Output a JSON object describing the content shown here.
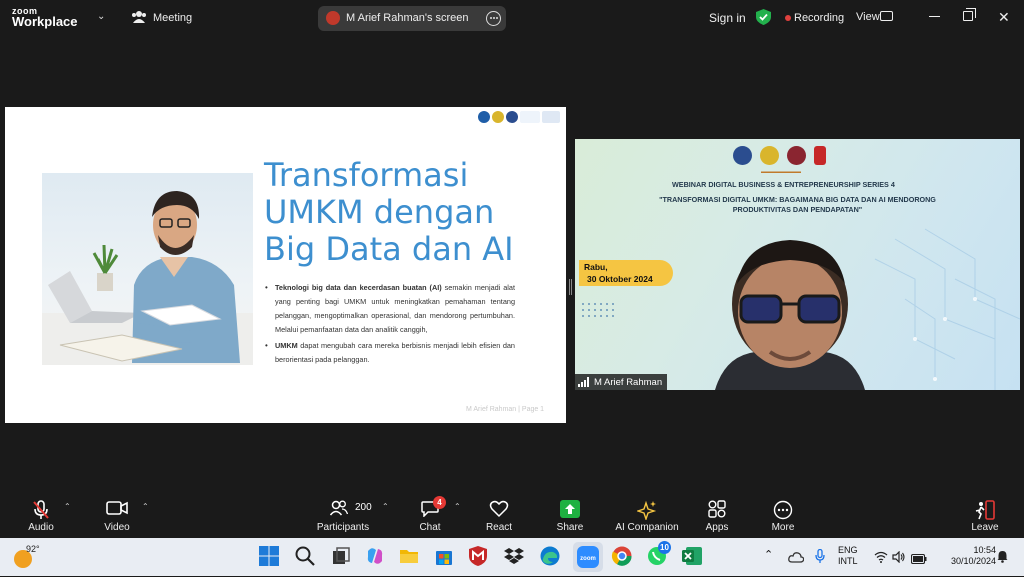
{
  "topbar": {
    "logo_line1": "zoom",
    "logo_line2": "Workplace",
    "meeting_label": "Meeting",
    "share_label": "M Arief Rahman's screen",
    "signin_label": "Sign in",
    "recording_label": "Recording",
    "view_label": "View"
  },
  "slide": {
    "title_lines": [
      "Transformasi",
      "UMKM dengan",
      "Big Data dan AI"
    ],
    "bullet1_bold": "Teknologi big data dan kecerdasan buatan (AI)",
    "bullet1_rest": " semakin menjadi alat yang penting bagi UMKM untuk meningkatkan pemahaman tentang pelanggan, mengoptimalkan operasional, dan mendorong pertumbuhan. Melalui pemanfaatan data dan analitik canggih,",
    "bullet2_bold": "UMKM",
    "bullet2_rest": " dapat mengubah cara mereka berbisnis menjadi lebih efisien dan berorientasi pada pelanggan.",
    "footer": "M Arief Rahman | Page 1",
    "colors": {
      "title": "#3d8fcf"
    }
  },
  "video": {
    "line1": "WEBINAR DIGITAL BUSINESS & ENTREPRENEURSHIP SERIES 4",
    "line2": "\"TRANSFORMASI DIGITAL UMKM: BAGAIMANA BIG DATA DAN AI MENDORONG PRODUKTIVITAS DAN PENDAPATAN\"",
    "date_day": "Rabu,",
    "date_date": "30 Oktober 2024",
    "participant_name": "M Arief Rahman"
  },
  "toolbar": {
    "audio": "Audio",
    "video": "Video",
    "participants": "Participants",
    "participants_count": "200",
    "chat": "Chat",
    "chat_badge": "4",
    "react": "React",
    "share": "Share",
    "ai_companion": "AI Companion",
    "apps": "Apps",
    "more": "More",
    "leave": "Leave",
    "colors": {
      "share": "#1fb141",
      "leave": "#e53935"
    }
  },
  "taskbar": {
    "weather_temp": "92°",
    "whatsapp_badge": "10",
    "lang_line1": "ENG",
    "lang_line2": "INTL",
    "time": "10:54",
    "date": "30/10/2024"
  }
}
